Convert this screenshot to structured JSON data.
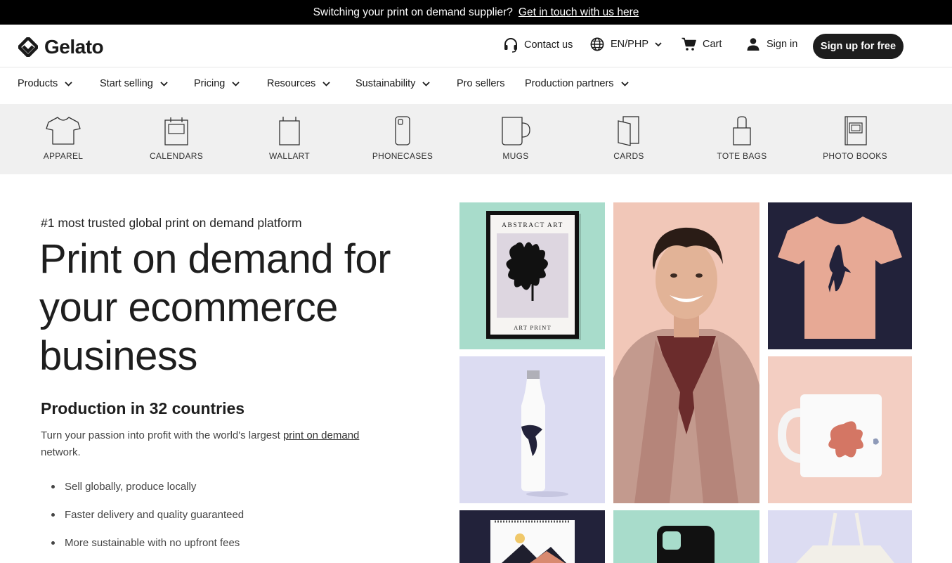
{
  "announcement": {
    "text": "Switching your print on demand supplier?",
    "link": "Get in touch with us here"
  },
  "header": {
    "logo": "Gelato",
    "contact": "Contact us",
    "locale": "EN/PHP",
    "cart": "Cart",
    "sign_in": "Sign in",
    "signup": "Sign up for free"
  },
  "nav": {
    "items": [
      "Products",
      "Start selling",
      "Pricing",
      "Resources",
      "Sustainability",
      "Pro sellers",
      "Production partners"
    ]
  },
  "categories": [
    {
      "label": "APPAREL",
      "icon": "tshirt-icon"
    },
    {
      "label": "CALENDARS",
      "icon": "calendar-icon"
    },
    {
      "label": "WALLART",
      "icon": "wallart-icon"
    },
    {
      "label": "PHONECASES",
      "icon": "phonecase-icon"
    },
    {
      "label": "MUGS",
      "icon": "mug-icon"
    },
    {
      "label": "CARDS",
      "icon": "cards-icon"
    },
    {
      "label": "TOTE BAGS",
      "icon": "tote-bag-icon"
    },
    {
      "label": "PHOTO BOOKS",
      "icon": "photo-book-icon"
    }
  ],
  "hero": {
    "eyebrow": "#1 most trusted global print on demand platform",
    "title": "Print on demand for your ecommerce business",
    "subtitle": "Production in 32 countries",
    "desc_before": "Turn your passion into profit with the world's largest ",
    "desc_link": "print on demand",
    "desc_after": " network.",
    "bullets": [
      "Sell globally, produce locally",
      "Faster delivery and quality guaranteed",
      "More sustainable with no upfront fees"
    ]
  },
  "poster": {
    "top": "ABSTRACT ART",
    "bottom": "ART PRINT"
  },
  "colors": {
    "announce_bg": "#000000",
    "signup_bg": "#1d1d1d",
    "category_bg": "#f0f0f0",
    "mint": "#a8dccb",
    "peach": "#f1c7b8",
    "navy": "#22223a",
    "lavender": "#dcdcf2"
  }
}
